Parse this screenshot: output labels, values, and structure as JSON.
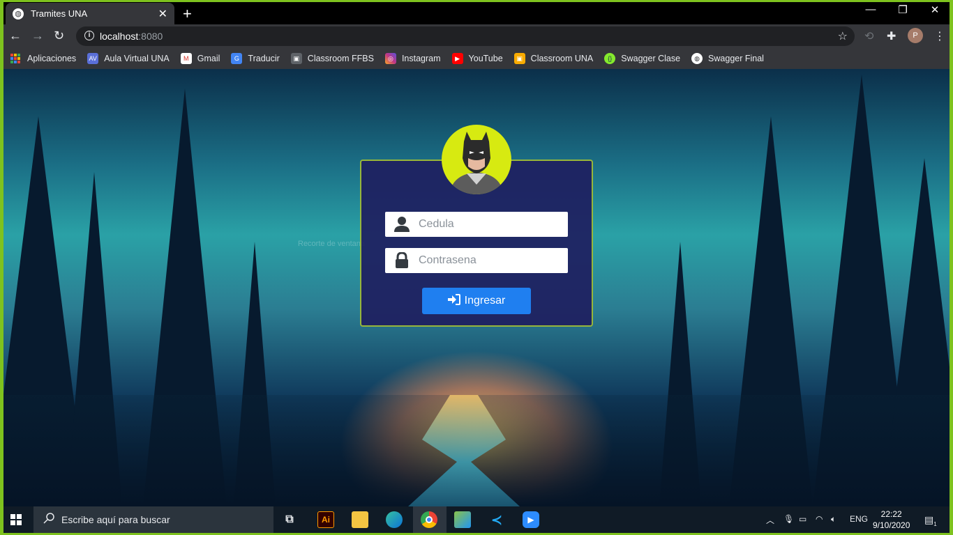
{
  "browser": {
    "tab_title": "Tramites UNA",
    "url_host": "localhost",
    "url_port": ":8080"
  },
  "bookmarks": [
    {
      "label": "Aplicaciones",
      "icon": "apps-grid-icon",
      "color": ""
    },
    {
      "label": "Aula Virtual UNA",
      "icon": "aula-virtual-icon",
      "color": "#5a6fd8"
    },
    {
      "label": "Gmail",
      "icon": "gmail-icon",
      "color": "#d93025"
    },
    {
      "label": "Traducir",
      "icon": "translate-icon",
      "color": "#4285f4"
    },
    {
      "label": "Classroom FFBS",
      "icon": "classroom-icon",
      "color": "#5f6368"
    },
    {
      "label": "Instagram",
      "icon": "instagram-icon",
      "color": "#c13584"
    },
    {
      "label": "YouTube",
      "icon": "youtube-icon",
      "color": "#ff0000"
    },
    {
      "label": "Classroom UNA",
      "icon": "classroom-icon",
      "color": "#f9ab00"
    },
    {
      "label": "Swagger Clase",
      "icon": "swagger-icon",
      "color": "#85ea2d"
    },
    {
      "label": "Swagger Final",
      "icon": "globe-icon",
      "color": "#ffffff"
    }
  ],
  "login": {
    "cedula_placeholder": "Cedula",
    "password_placeholder": "Contrasena",
    "submit_label": "Ingresar",
    "accent": "#1f7ff0",
    "card_border": "#97b63a",
    "avatar_bg": "#d7ea11"
  },
  "overlay_text": "Recorte de ventana",
  "taskbar": {
    "search_placeholder": "Escribe aquí para buscar",
    "lang": "ENG",
    "time": "22:22",
    "date": "9/10/2020",
    "notification_count": "1"
  }
}
